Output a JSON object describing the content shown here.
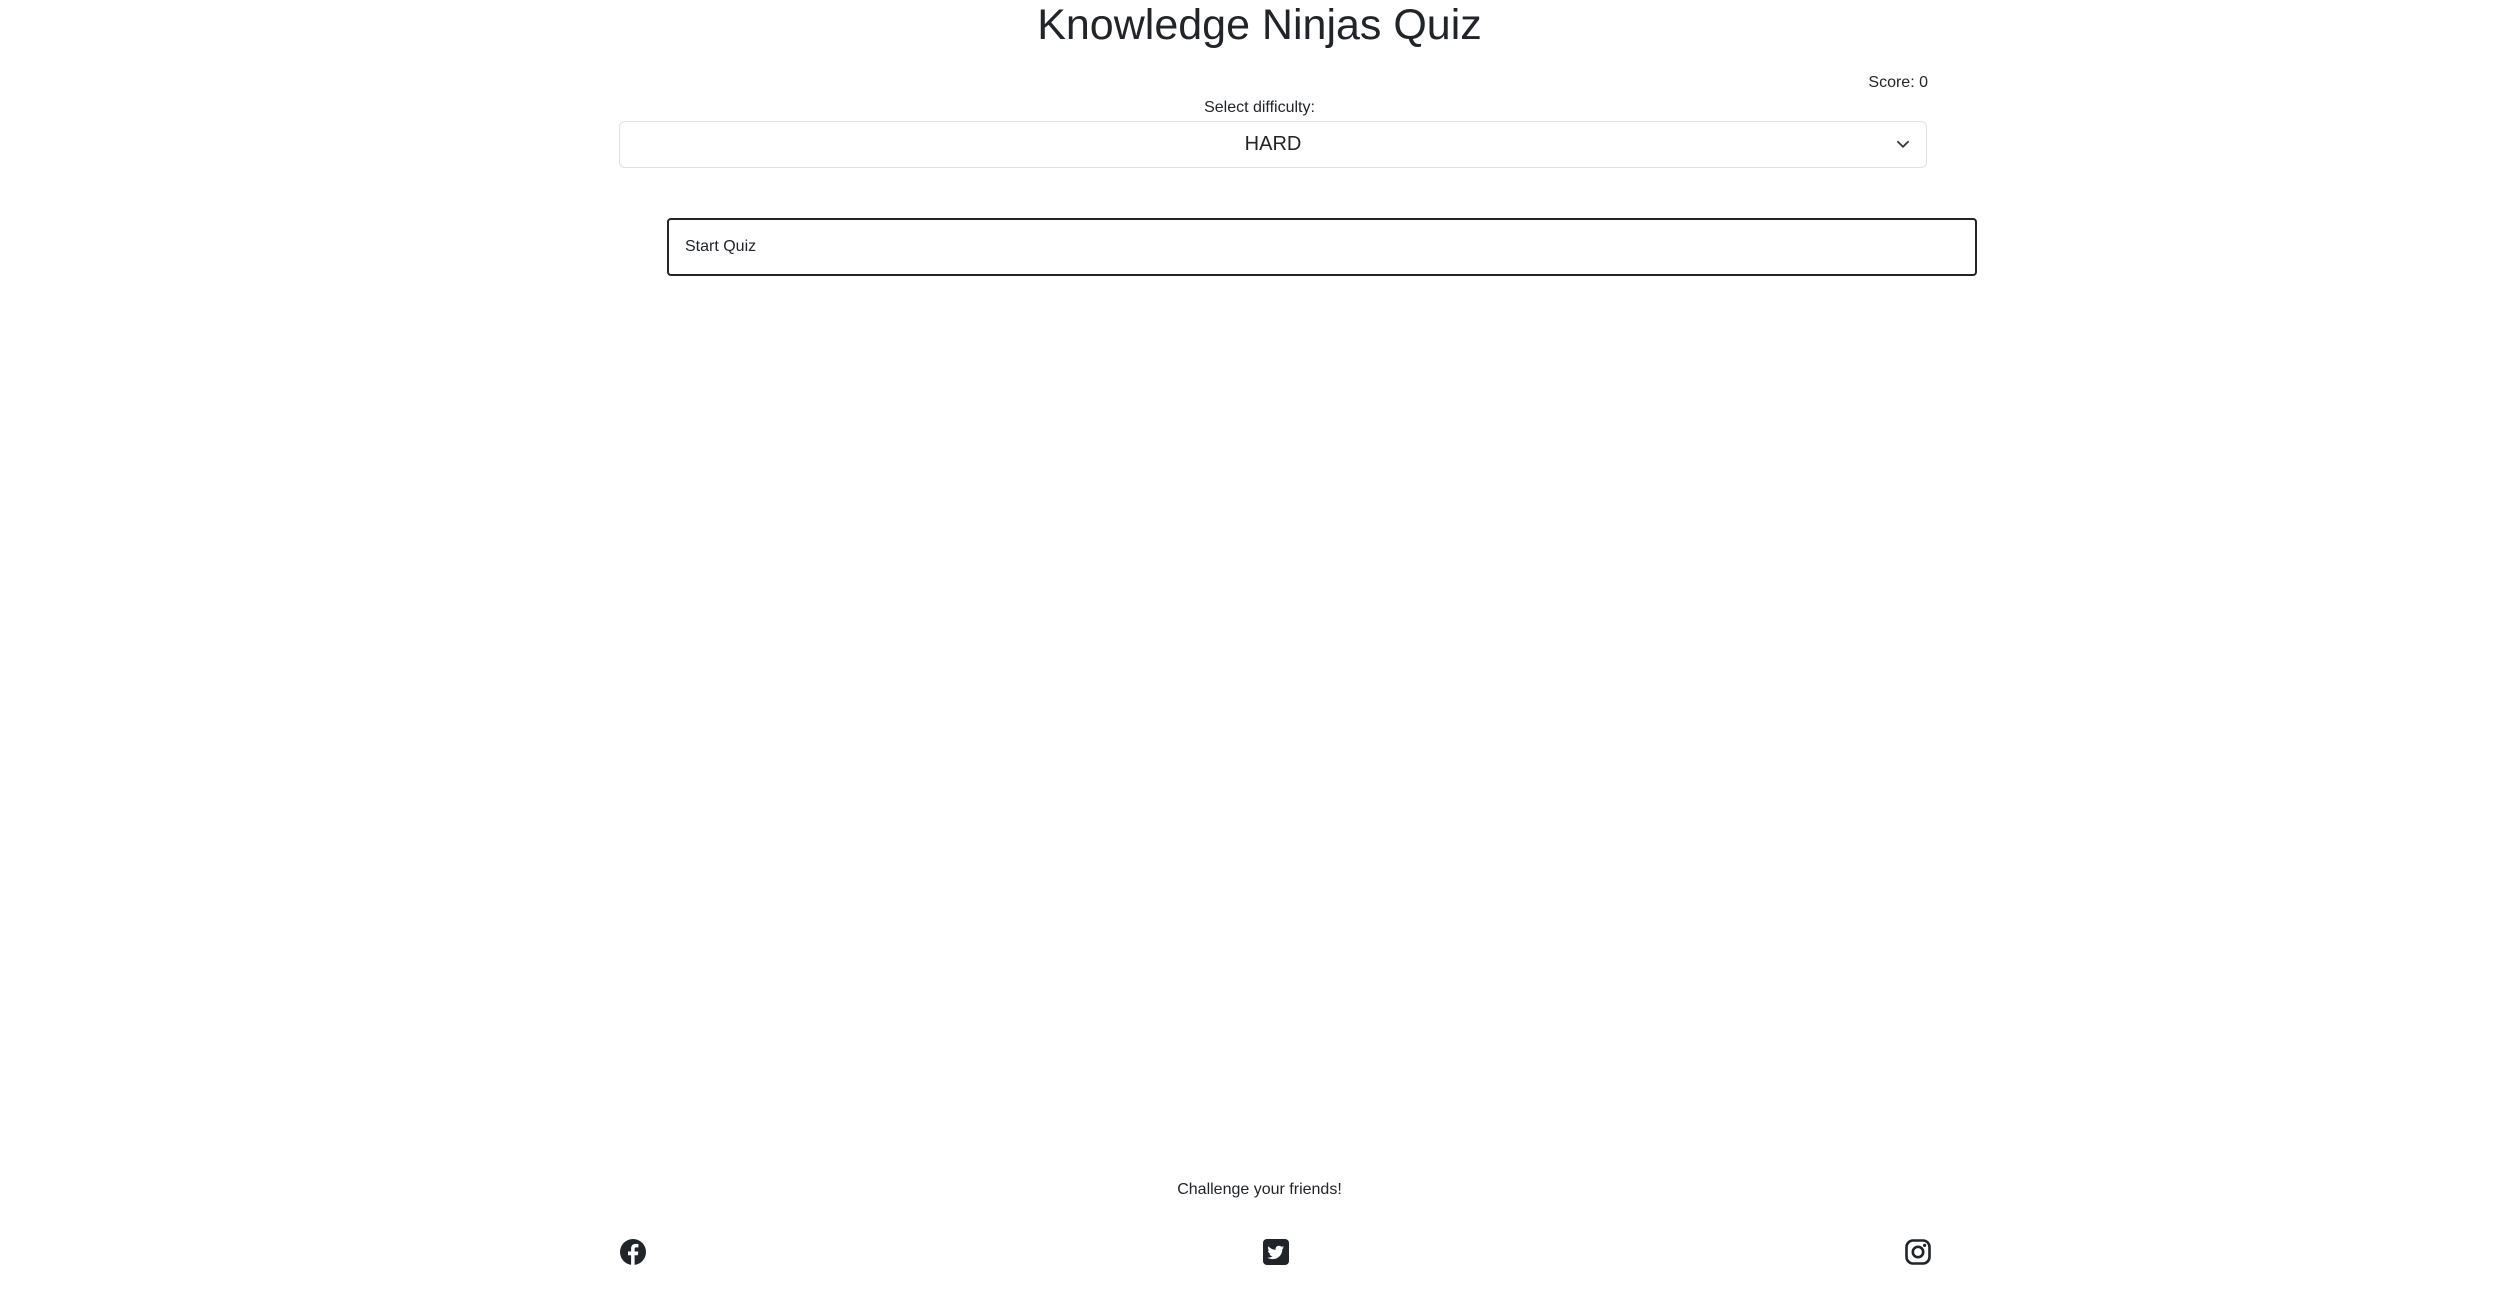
{
  "header": {
    "title": "Knowledge Ninjas Quiz",
    "score_text": "Score: 0"
  },
  "difficulty": {
    "label": "Select difficulty:",
    "selected": "HARD",
    "icon": "chevron-down-icon"
  },
  "quiz": {
    "start_label": "Start Quiz"
  },
  "footer": {
    "tagline": "Challenge your friends!",
    "social": [
      {
        "icon": "facebook-icon"
      },
      {
        "icon": "twitter-icon"
      },
      {
        "icon": "instagram-icon"
      }
    ]
  },
  "colors": {
    "text": "#212529",
    "border_light": "#dee2e6",
    "background": "#ffffff"
  }
}
